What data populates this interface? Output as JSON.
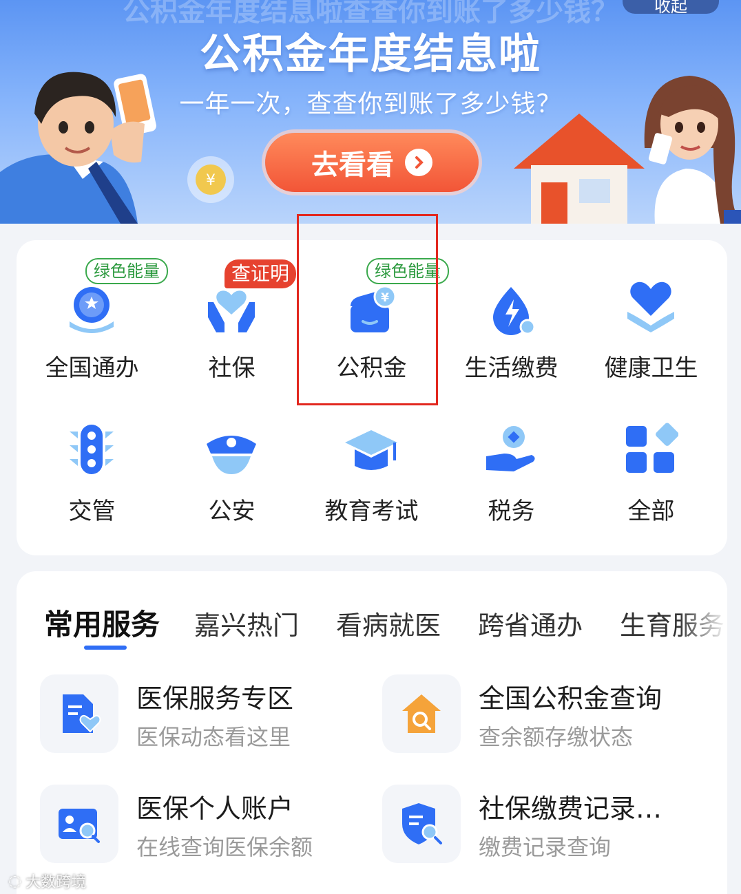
{
  "banner": {
    "ghost_text": "公积金年度结息啦查查你到账了多少钱？",
    "collapse_label": "收起",
    "title": "公积金年度结息啦",
    "subtitle": "一年一次，查查你到账了多少钱？",
    "button_label": "去看看"
  },
  "grid": {
    "items": [
      {
        "label": "全国通办",
        "badge": "绿色能量",
        "icon": "globe-hand-icon"
      },
      {
        "label": "社保",
        "badge": "查证明",
        "icon": "hands-heart-icon"
      },
      {
        "label": "公积金",
        "badge": "绿色能量",
        "icon": "wallet-yen-icon"
      },
      {
        "label": "生活缴费",
        "badge": "",
        "icon": "lightning-drop-icon"
      },
      {
        "label": "健康卫生",
        "badge": "",
        "icon": "heart-hand-icon"
      },
      {
        "label": "交管",
        "badge": "",
        "icon": "traffic-light-icon"
      },
      {
        "label": "公安",
        "badge": "",
        "icon": "police-cap-icon"
      },
      {
        "label": "教育考试",
        "badge": "",
        "icon": "graduation-cap-icon"
      },
      {
        "label": "税务",
        "badge": "",
        "icon": "coin-hand-icon"
      },
      {
        "label": "全部",
        "badge": "",
        "icon": "apps-grid-icon"
      }
    ]
  },
  "tabs": [
    "常用服务",
    "嘉兴热门",
    "看病就医",
    "跨省通办",
    "生育服务"
  ],
  "services": [
    {
      "title": "医保服务专区",
      "subtitle": "医保动态看这里",
      "icon": "medical-doc-icon"
    },
    {
      "title": "全国公积金查询",
      "subtitle": "查余额存缴状态",
      "icon": "house-search-icon"
    },
    {
      "title": "医保个人账户",
      "subtitle": "在线查询医保余额",
      "icon": "id-card-search-icon"
    },
    {
      "title": "社保缴费记录…",
      "subtitle": "缴费记录查询",
      "icon": "shield-search-icon"
    }
  ],
  "watermark": "大数跨境",
  "colors": {
    "accent": "#2f6ef5",
    "highlight": "#e2281f",
    "badge_green": "#3aa94c",
    "badge_red": "#e6422f"
  }
}
